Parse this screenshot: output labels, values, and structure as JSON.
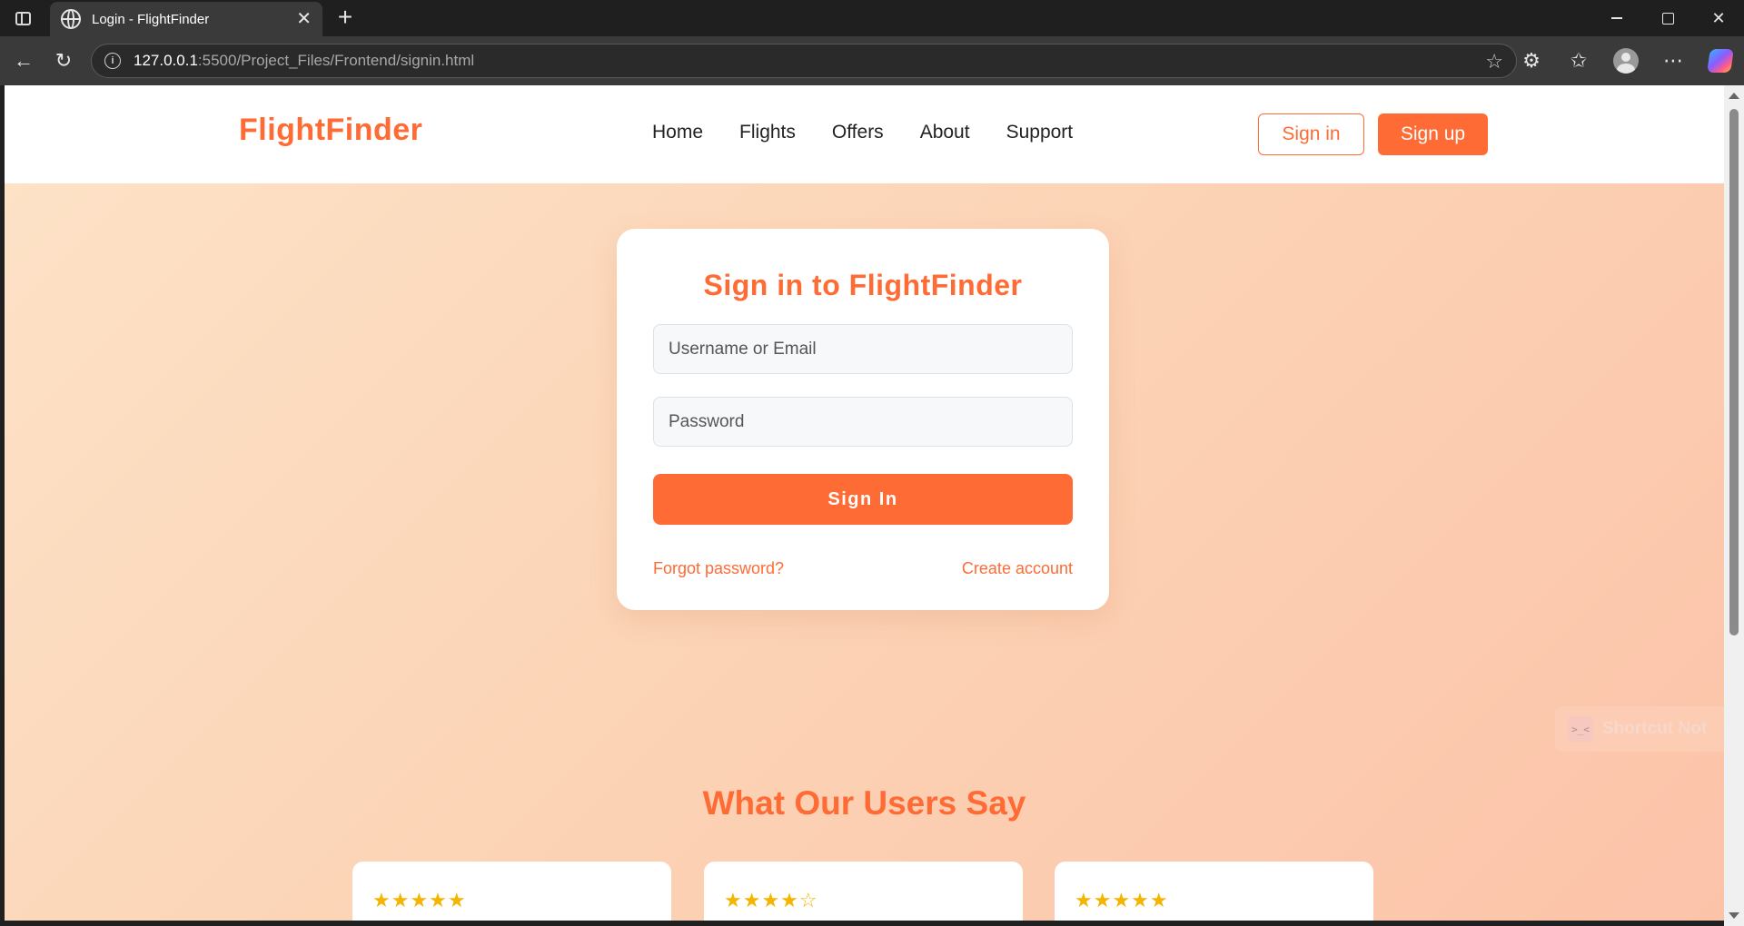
{
  "browser": {
    "tab_title": "Login - FlightFinder",
    "url_host": "127.0.0.1",
    "url_path": ":5500/Project_Files/Frontend/signin.html"
  },
  "header": {
    "logo": "FlightFinder",
    "nav": [
      "Home",
      "Flights",
      "Offers",
      "About",
      "Support"
    ],
    "signin_label": "Sign in",
    "signup_label": "Sign up"
  },
  "login": {
    "title": "Sign in to FlightFinder",
    "username_placeholder": "Username or Email",
    "password_placeholder": "Password",
    "submit_label": "Sign In",
    "forgot_label": "Forgot password?",
    "create_label": "Create account"
  },
  "toast": {
    "icon_text": ">_<",
    "text": "Shortcut Not"
  },
  "testimonials": {
    "title": "What Our Users Say",
    "reviews": [
      {
        "stars": "★★★★★"
      },
      {
        "stars": "★★★★☆"
      },
      {
        "stars": "★★★★★"
      }
    ]
  },
  "colors": {
    "brand": "#ff6b35",
    "star": "#f5b400"
  }
}
